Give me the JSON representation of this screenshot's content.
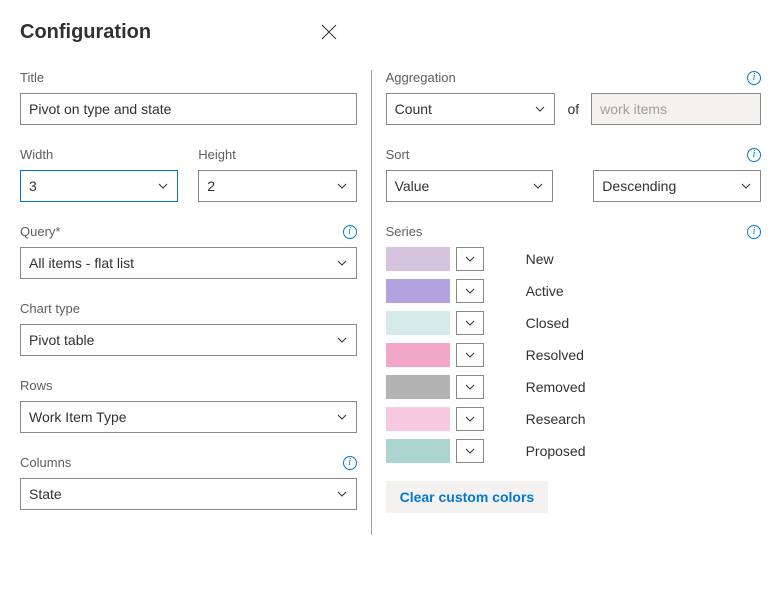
{
  "header": {
    "title": "Configuration"
  },
  "left": {
    "title_label": "Title",
    "title_value": "Pivot on type and state",
    "width_label": "Width",
    "width_value": "3",
    "height_label": "Height",
    "height_value": "2",
    "query_label": "Query*",
    "query_value": "All items - flat list",
    "chart_type_label": "Chart type",
    "chart_type_value": "Pivot table",
    "rows_label": "Rows",
    "rows_value": "Work Item Type",
    "columns_label": "Columns",
    "columns_value": "State"
  },
  "right": {
    "aggregation_label": "Aggregation",
    "aggregation_value": "Count",
    "of_label": "of",
    "of_value": "work items",
    "sort_label": "Sort",
    "sort_by_value": "Value",
    "sort_dir_value": "Descending",
    "series_label": "Series",
    "clear_label": "Clear custom colors",
    "series": [
      {
        "label": "New",
        "color": "#d6c3de"
      },
      {
        "label": "Active",
        "color": "#b0a3e0"
      },
      {
        "label": "Closed",
        "color": "#d5ebe8"
      },
      {
        "label": "Resolved",
        "color": "#f2a6c8"
      },
      {
        "label": "Removed",
        "color": "#b3b3b3"
      },
      {
        "label": "Research",
        "color": "#f7cae1"
      },
      {
        "label": "Proposed",
        "color": "#add5d0"
      }
    ]
  }
}
